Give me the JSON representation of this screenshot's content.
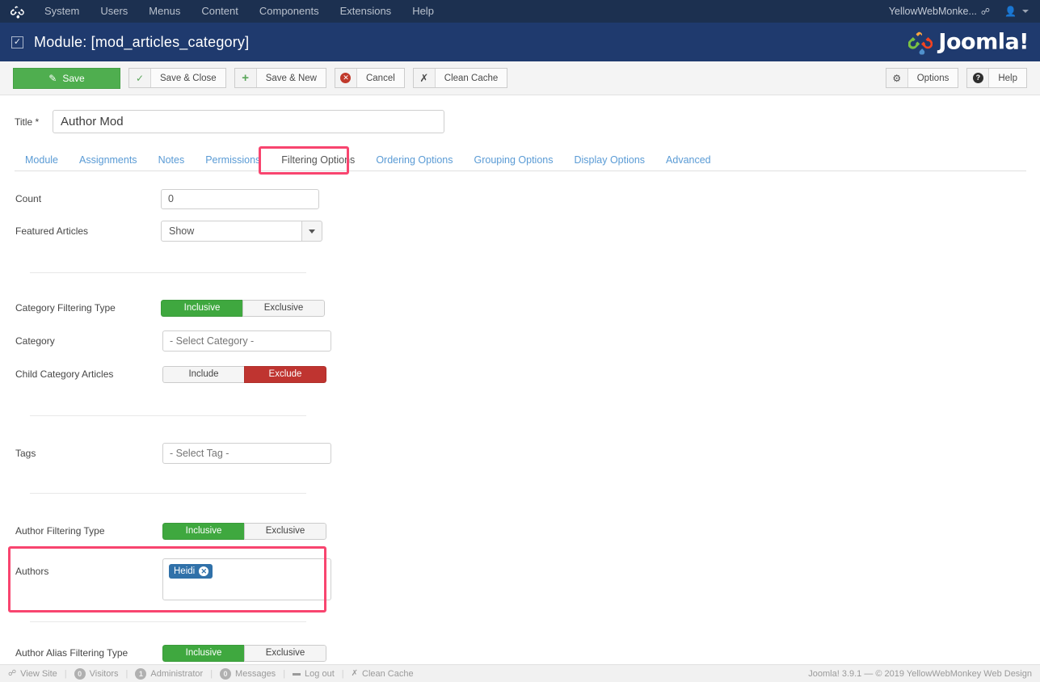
{
  "topbar": {
    "brand_icon": "joomla-logo-icon",
    "menu": [
      {
        "label": "System"
      },
      {
        "label": "Users"
      },
      {
        "label": "Menus"
      },
      {
        "label": "Content"
      },
      {
        "label": "Components"
      },
      {
        "label": "Extensions"
      },
      {
        "label": "Help"
      }
    ],
    "site_name": "YellowWebMonke...",
    "external_icon": "external-link-icon",
    "user_icon": "user-icon"
  },
  "subheader": {
    "checkbox_icon": "checkbox-checked-icon",
    "title": "Module: [mod_articles_category]",
    "logo_text": "Joomla!"
  },
  "toolbar": {
    "save": "Save",
    "save_close": "Save & Close",
    "save_new": "Save & New",
    "cancel": "Cancel",
    "clean_cache": "Clean Cache",
    "options": "Options",
    "help": "Help"
  },
  "form": {
    "title_label": "Title *",
    "title_value": "Author Mod",
    "title_placeholder": ""
  },
  "tabs": [
    {
      "label": "Module",
      "active": false
    },
    {
      "label": "Assignments",
      "active": false
    },
    {
      "label": "Notes",
      "active": false
    },
    {
      "label": "Permissions",
      "active": false
    },
    {
      "label": "Filtering Options",
      "active": true
    },
    {
      "label": "Ordering Options",
      "active": false
    },
    {
      "label": "Grouping Options",
      "active": false
    },
    {
      "label": "Display Options",
      "active": false
    },
    {
      "label": "Advanced",
      "active": false
    }
  ],
  "fields": {
    "count_label": "Count",
    "count_value": "0",
    "featured_label": "Featured Articles",
    "featured_value": "Show",
    "cat_filter_label": "Category Filtering Type",
    "cat_filter_inclusive": "Inclusive",
    "cat_filter_exclusive": "Exclusive",
    "category_label": "Category",
    "category_placeholder": "- Select Category -",
    "child_label": "Child Category Articles",
    "child_include": "Include",
    "child_exclude": "Exclude",
    "tags_label": "Tags",
    "tags_placeholder": "- Select Tag -",
    "author_filter_label": "Author Filtering Type",
    "author_filter_inclusive": "Inclusive",
    "author_filter_exclusive": "Exclusive",
    "authors_label": "Authors",
    "author_chip": "Heidi",
    "author_chip_remove_icon": "remove-chip-icon",
    "alias_filter_label": "Author Alias Filtering Type",
    "alias_inclusive": "Inclusive",
    "alias_exclusive": "Exclusive"
  },
  "statusbar": {
    "view_site": "View Site",
    "visitors_count": "0",
    "visitors": "Visitors",
    "admin_count": "1",
    "administrator": "Administrator",
    "messages_count": "0",
    "messages": "Messages",
    "logout": "Log out",
    "clean_cache": "Clean Cache",
    "copyright": "Joomla! 3.9.1  —  © 2019 YellowWebMonkey Web Design"
  },
  "colors": {
    "topbar_bg": "#1c3050",
    "subheader_bg": "#1f3a6e",
    "save_green": "#4fae4f",
    "toggle_green": "#3fa83f",
    "toggle_red": "#bf3430",
    "chip_blue": "#3071a9",
    "highlight_pink": "#f8456f",
    "tab_link": "#5a9bd5"
  }
}
